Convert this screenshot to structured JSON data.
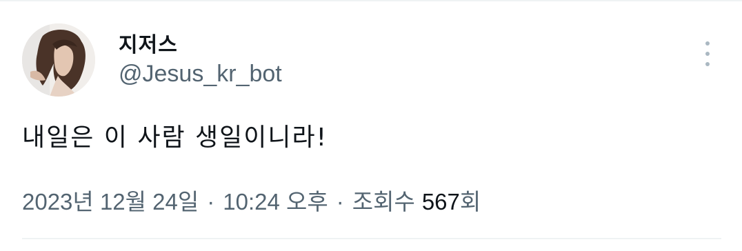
{
  "tweet": {
    "display_name": "지저스",
    "handle": "@Jesus_kr_bot",
    "text": "내일은 이 사람 생일이니라!",
    "date": "2023년 12월 24일",
    "separator": "·",
    "time": "10:24 오후",
    "views_label": "조회수",
    "views_count": "567",
    "views_suffix": "회"
  },
  "icons": {
    "avatar": "profile-photo",
    "more": "more-vertical-icon"
  },
  "colors": {
    "primary_text": "#0f1419",
    "secondary_text": "#536471",
    "divider": "#eff3f4",
    "more_dots": "#aab8c2"
  }
}
